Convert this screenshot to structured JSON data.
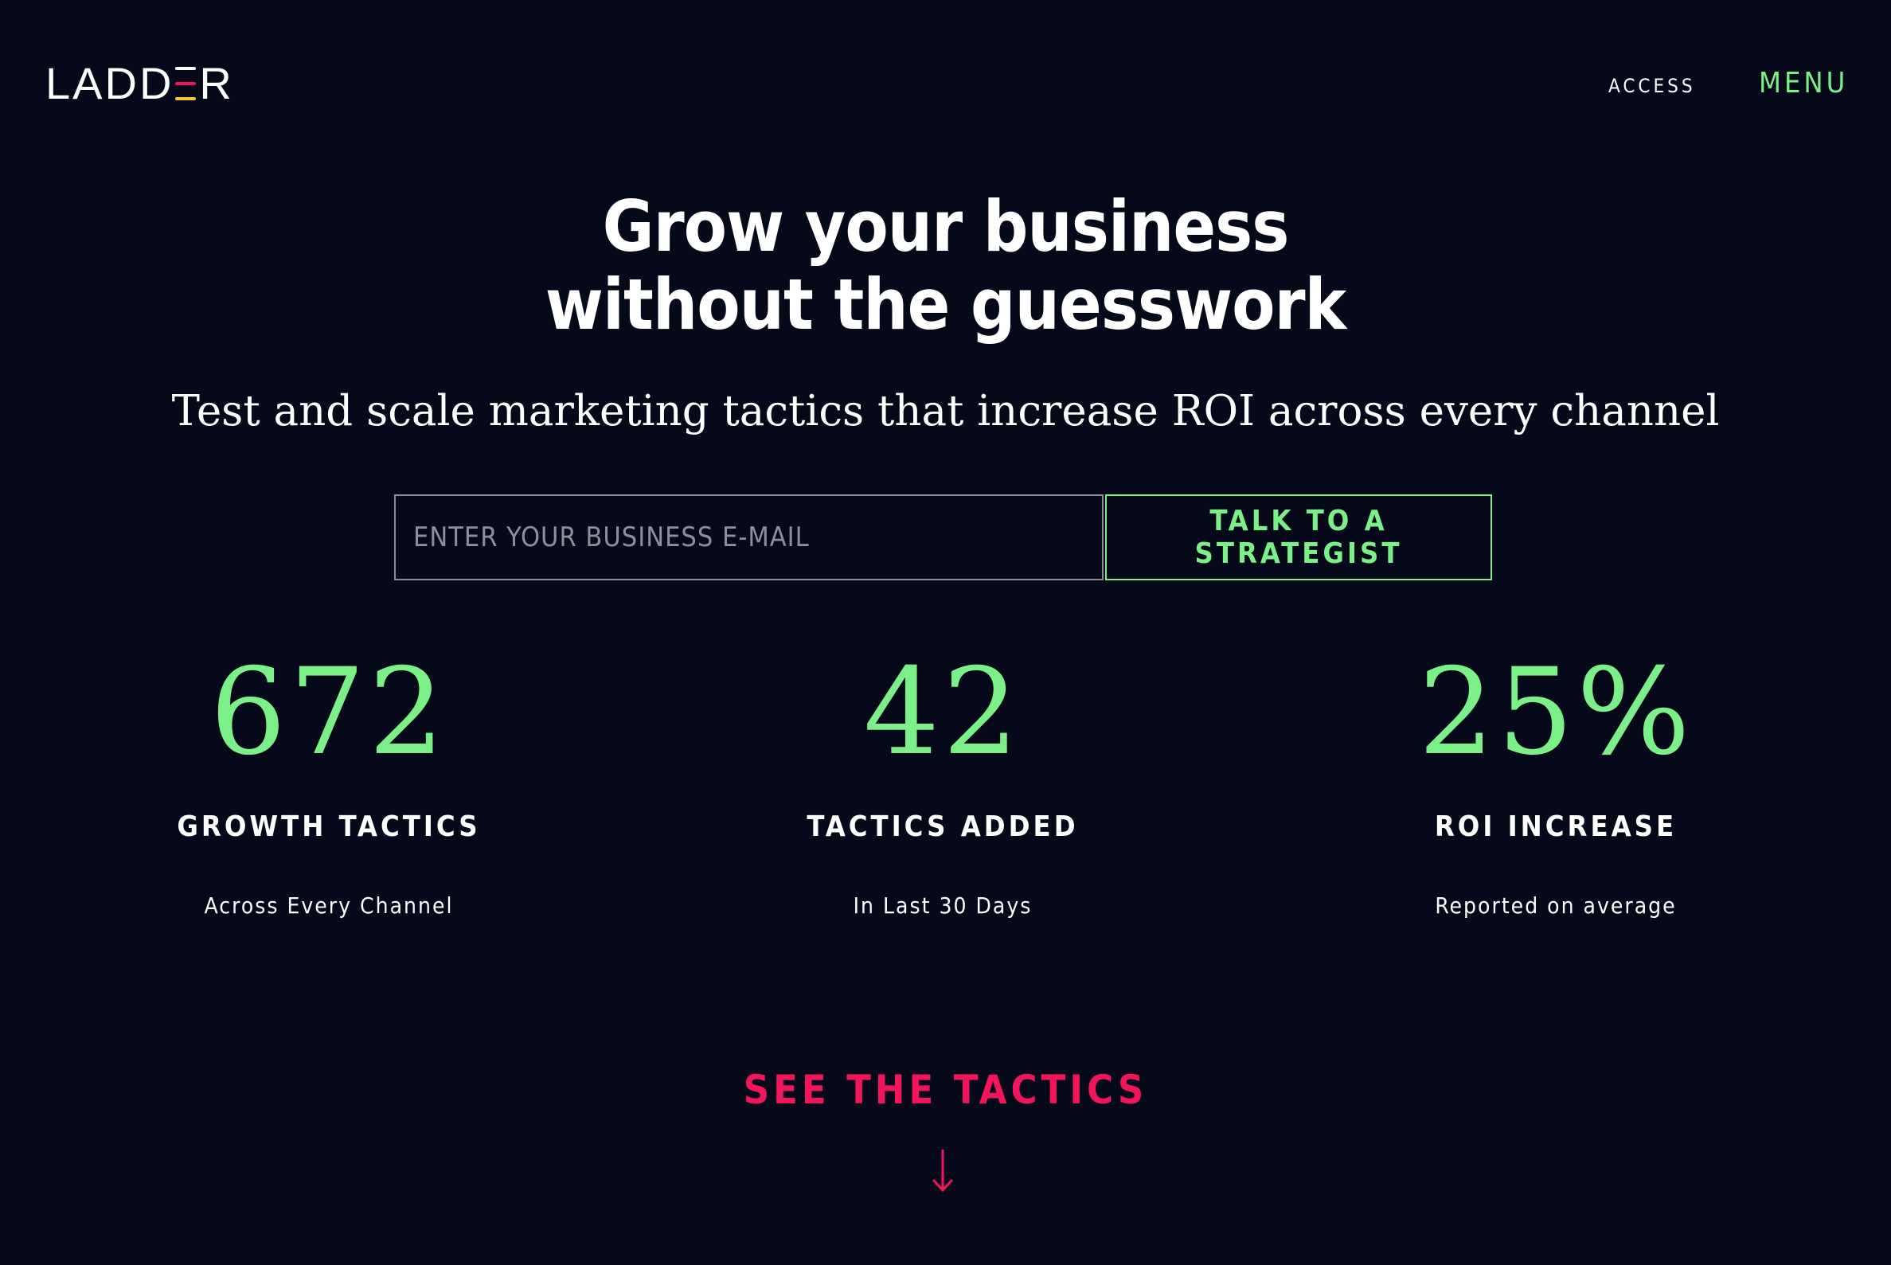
{
  "header": {
    "logo": "LADDER",
    "logo_stripe_colors": [
      "#f7c235",
      "#f2155c",
      "#7cf088"
    ],
    "nav_access": "ACCESS",
    "nav_menu": "MENU"
  },
  "hero": {
    "title_line1": "Grow your business",
    "title_line2": "without the guesswork",
    "subtitle": "Test and scale marketing tactics that increase ROI across every channel"
  },
  "form": {
    "email_placeholder": "ENTER YOUR BUSINESS E-MAIL",
    "email_value": "",
    "cta_label": "TALK TO A STRATEGIST"
  },
  "stats": [
    {
      "value": "672",
      "label": "GROWTH TACTICS",
      "caption": "Across Every Channel"
    },
    {
      "value": "42",
      "label": "TACTICS ADDED",
      "caption": "In Last 30 Days"
    },
    {
      "value": "25%",
      "label": "ROI INCREASE",
      "caption": "Reported on average"
    }
  ],
  "bottom": {
    "see_tactics_label": "SEE THE TACTICS",
    "arrow_icon": "arrow-down-icon"
  },
  "colors": {
    "background": "#05091a",
    "accent_green": "#7cf088",
    "accent_pink": "#f2155c",
    "text": "#ffffff"
  }
}
